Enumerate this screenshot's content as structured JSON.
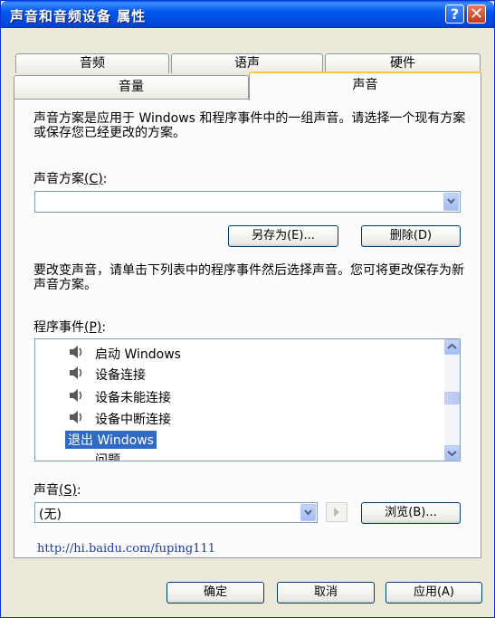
{
  "window": {
    "title": "声音和音频设备 属性",
    "help_glyph": "?",
    "close_glyph": "✕"
  },
  "tabs": {
    "row_back": [
      "音频",
      "语声",
      "硬件"
    ],
    "row_front": [
      "音量",
      "声音"
    ],
    "active": "声音"
  },
  "scheme": {
    "description": "声音方案是应用于 Windows 和程序事件中的一组声音。请选择一个现有方案或保存您已经更改的方案。",
    "label": "声音方案",
    "label_key": "(C)",
    "label_colon": ":",
    "selected": "",
    "save_as_label": "另存为(E)...",
    "delete_label": "删除(D)"
  },
  "events": {
    "instructions": "要改变声音，请单击下列表中的程序事件然后选择声音。您可将更改保存为新声音方案。",
    "label": "程序事件",
    "label_key": "(P)",
    "label_colon": ":",
    "items": [
      "启动 Windows",
      "设备连接",
      "设备未能连接",
      "设备中断连接",
      "退出 Windows",
      "问题"
    ],
    "selected": "退出 Windows"
  },
  "sound": {
    "label": "声音",
    "label_key": "(S)",
    "label_colon": ":",
    "selected": "(无)",
    "browse_label": "浏览(B)..."
  },
  "watermark": "http://hi.baidu.com/fuping111",
  "footer": {
    "ok_label": "确定",
    "cancel_label": "取消",
    "apply_label": "应用(A)"
  },
  "colors": {
    "titlebar": "#0058EE",
    "selection": "#316AC5",
    "tab_highlight": "#FFC83C",
    "face": "#ECE9D8"
  }
}
